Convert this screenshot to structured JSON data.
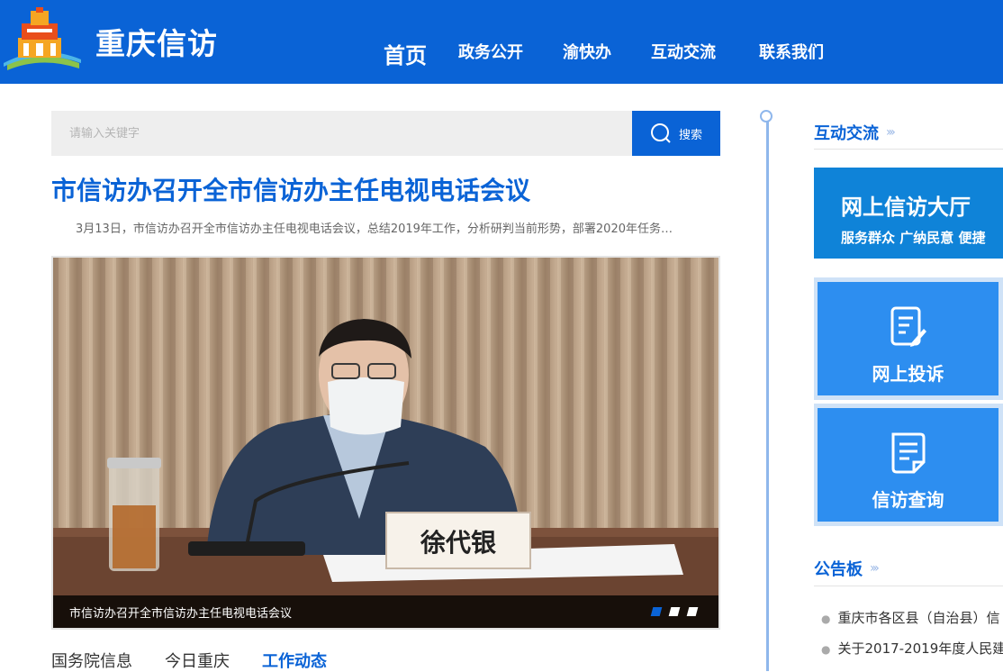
{
  "header": {
    "site_title": "重庆信访",
    "nav": [
      {
        "label": "首页",
        "active": true
      },
      {
        "label": "政务公开"
      },
      {
        "label": "渝快办"
      },
      {
        "label": "互动交流"
      },
      {
        "label": "联系我们"
      }
    ]
  },
  "search": {
    "placeholder": "请输入关键字",
    "button_label": "搜索"
  },
  "headline": {
    "title": "市信访办召开全市信访办主任电视电话会议",
    "summary": "3月13日，市信访办召开全市信访办主任电视电话会议，总结2019年工作，分析研判当前形势，部署2020年任务…"
  },
  "slider": {
    "caption": "市信访办召开全市信访办主任电视电话会议",
    "nameplate": "徐代银",
    "active_index": 0,
    "count": 3
  },
  "tabs": [
    {
      "label": "国务院信息"
    },
    {
      "label": "今日重庆"
    },
    {
      "label": "工作动态",
      "active": true
    }
  ],
  "sidebar": {
    "interaction_title": "互动交流",
    "hall_title": "网上信访大厅",
    "hall_subtitle": "服务群众  广纳民意  便捷",
    "tiles": [
      {
        "label": "网上投诉",
        "icon": "complaint-form-icon"
      },
      {
        "label": "信访查询",
        "icon": "document-query-icon"
      }
    ],
    "notice_title": "公告板",
    "notices": [
      "重庆市各区县（自治县）信",
      "关于2017-2019年度人民建"
    ]
  },
  "colors": {
    "brand_blue": "#0a63d6",
    "tile_blue": "#2d8ef0",
    "hall_blue": "#0f83d8"
  }
}
